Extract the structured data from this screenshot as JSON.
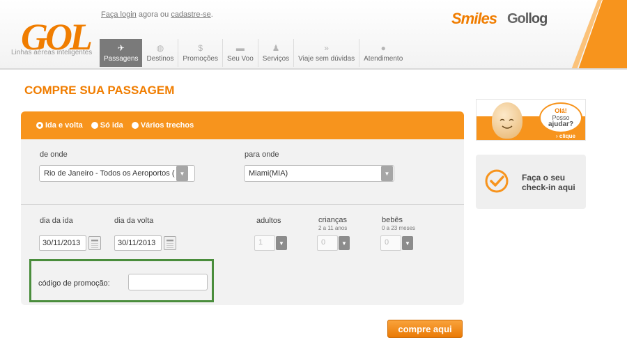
{
  "header": {
    "logo_text": "GOL",
    "tagline": "Linhas aéreas inteligentes",
    "login_link": "Faça login",
    "login_middle": " agora ou ",
    "signup_link": "cadastre-se",
    "login_end": ".",
    "brand_smiles": "Smiles",
    "brand_gollog_a": "Gol",
    "brand_gollog_b": "log"
  },
  "nav": [
    {
      "label": "Passagens",
      "icon": "airplane-icon",
      "active": true
    },
    {
      "label": "Destinos",
      "icon": "globe-icon"
    },
    {
      "label": "Promoções",
      "icon": "dollar-icon"
    },
    {
      "label": "Seu Voo",
      "icon": "suitcase-icon"
    },
    {
      "label": "Serviços",
      "icon": "person-icon"
    },
    {
      "label": "Viaje sem dúvidas",
      "icon": "double-chevron-icon"
    },
    {
      "label": "Atendimento",
      "icon": "chat-bubble-icon"
    }
  ],
  "title": "COMPRE SUA PASSAGEM",
  "trip_types": [
    {
      "label": "Ida e volta",
      "selected": true
    },
    {
      "label": "Só ida",
      "selected": false
    },
    {
      "label": "Vários trechos",
      "selected": false
    }
  ],
  "origin": {
    "label": "de onde",
    "value": "Rio de Janeiro - Todos os Aeroportos ("
  },
  "destination": {
    "label": "para onde",
    "value": "Miami(MIA)"
  },
  "dates": {
    "departure_label": "dia da ida",
    "departure_value": "30/11/2013",
    "return_label": "dia da volta",
    "return_value": "30/11/2013"
  },
  "passengers": {
    "adults_label": "adultos",
    "adults_value": "1",
    "children_label": "crianças",
    "children_sub": "2 a 11 anos",
    "children_value": "0",
    "infants_label": "bebês",
    "infants_sub": "0 a 23 meses",
    "infants_value": "0"
  },
  "promo": {
    "label": "código de promoção:",
    "value": ""
  },
  "submit_label": "compre aqui",
  "help": {
    "line1": "Olá!",
    "line2": "Posso",
    "line3": "ajudar?",
    "link": "› clique"
  },
  "checkin": {
    "line1": "Faça o seu",
    "line2": "check-in aqui"
  },
  "colors": {
    "brand_orange": "#f7941d",
    "promo_border": "#4a8d3c"
  }
}
